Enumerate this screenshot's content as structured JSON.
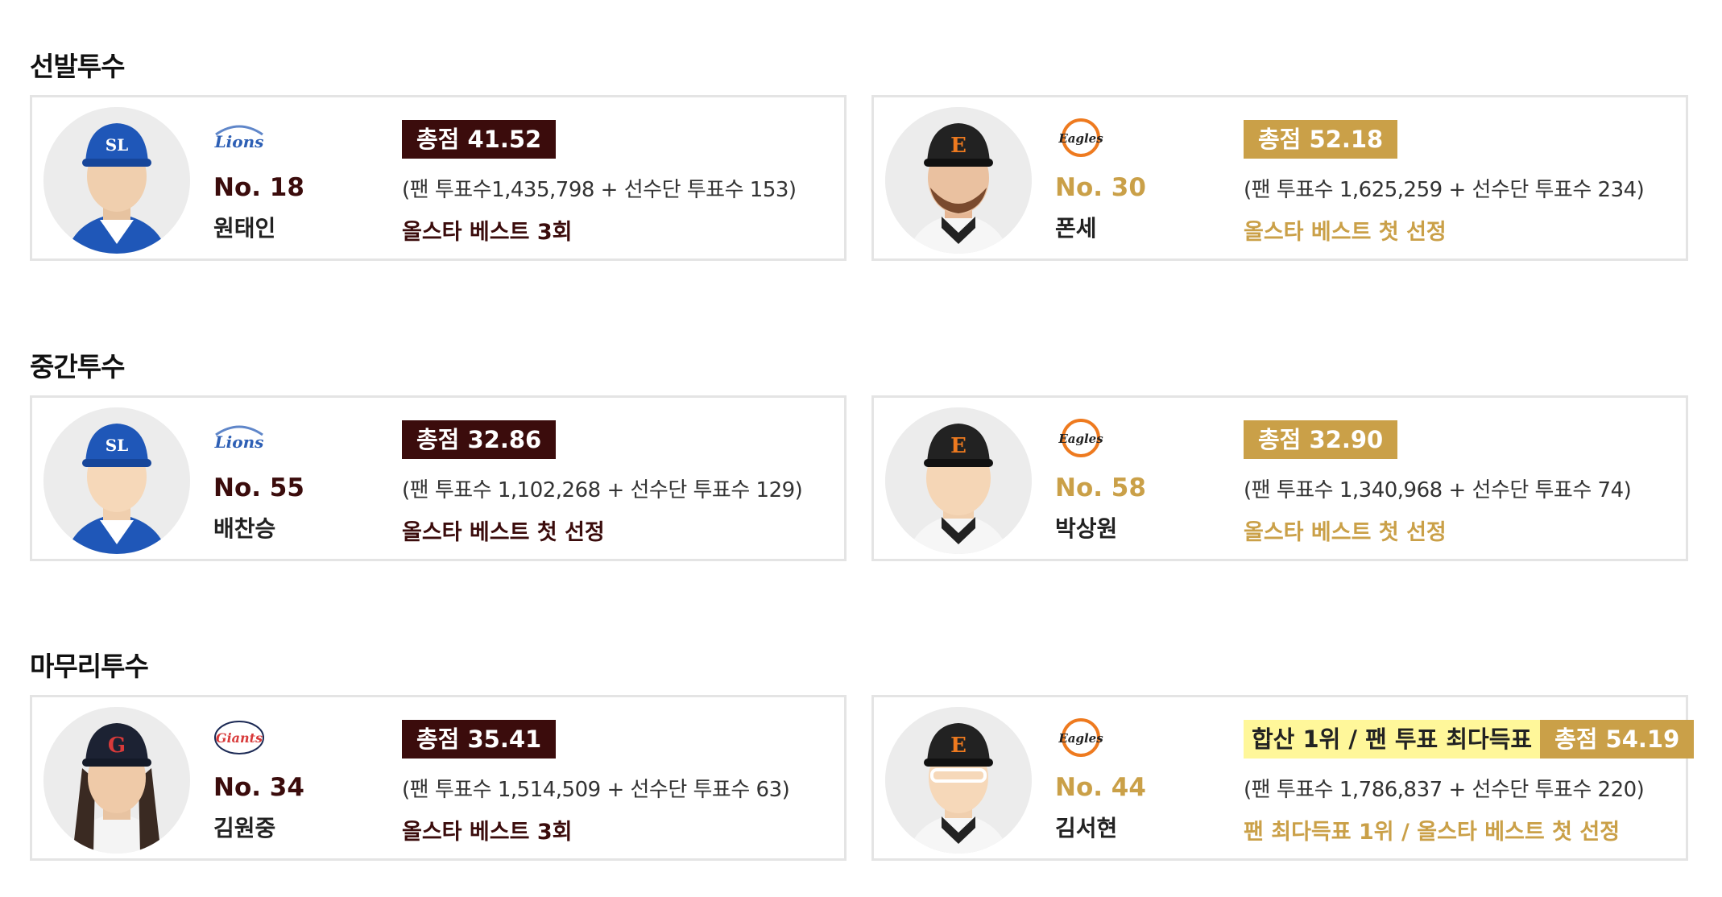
{
  "colors": {
    "dark_badge": "#3b0c0c",
    "gold_badge": "#caa048",
    "highlight": "#fff79a",
    "card_border": "#e4e4e4"
  },
  "sections": [
    {
      "title": "선발투수",
      "players": [
        {
          "team_logo": "Lions",
          "number": "No. 18",
          "name": "원태인",
          "score": "총점 41.52",
          "votes": "(팬 투표수1,435,798 + 선수단 투표수 153)",
          "note": "올스타 베스트 3회"
        },
        {
          "team_logo": "Eagles",
          "number": "No. 30",
          "name": "폰세",
          "score": "총점 52.18",
          "votes": "(팬 투표수 1,625,259 + 선수단 투표수 234)",
          "note": "올스타 베스트 첫 선정"
        }
      ]
    },
    {
      "title": "중간투수",
      "players": [
        {
          "team_logo": "Lions",
          "number": "No. 55",
          "name": "배찬승",
          "score": "총점 32.86",
          "votes": "(팬 투표수 1,102,268 + 선수단 투표수 129)",
          "note": "올스타 베스트 첫 선정"
        },
        {
          "team_logo": "Eagles",
          "number": "No. 58",
          "name": "박상원",
          "score": "총점 32.90",
          "votes": "(팬 투표수 1,340,968 + 선수단 투표수 74)",
          "note": "올스타 베스트 첫 선정"
        }
      ]
    },
    {
      "title": "마무리투수",
      "players": [
        {
          "team_logo": "Giants",
          "number": "No. 34",
          "name": "김원중",
          "score": "총점 35.41",
          "votes": "(팬 투표수 1,514,509 + 선수단 투표수 63)",
          "note": "올스타 베스트 3회"
        },
        {
          "team_logo": "Eagles",
          "number": "No. 44",
          "name": "김서현",
          "highlight": "합산 1위 / 팬 투표 최다득표",
          "score": "총점 54.19",
          "votes": "(팬 투표수 1,786,837 + 선수단 투표수 220)",
          "note": "팬 최다득표 1위 / 올스타 베스트 첫 선정"
        }
      ]
    }
  ]
}
